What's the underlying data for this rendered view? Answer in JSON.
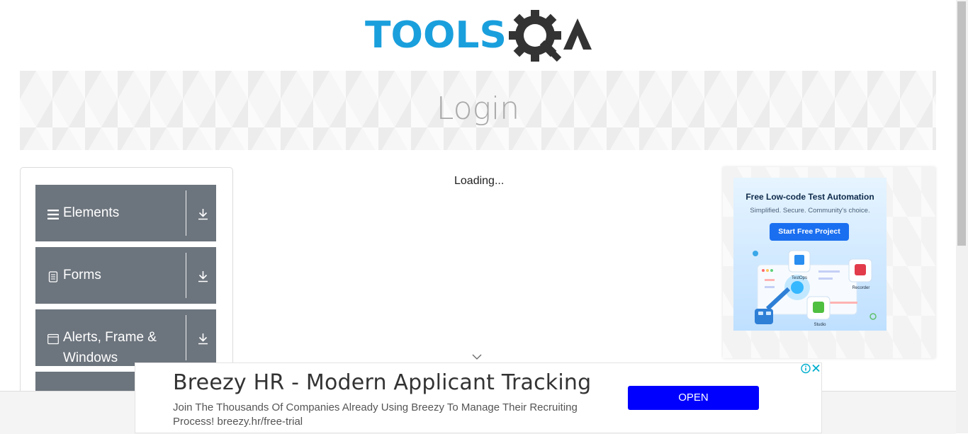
{
  "logo": {
    "text_left": "TOOLS",
    "text_right": "QA"
  },
  "page": {
    "title": "Login",
    "loading_text": "Loading..."
  },
  "sidebar": {
    "groups": [
      {
        "label": "Elements",
        "icon": "hamburger-icon"
      },
      {
        "label": "Forms",
        "icon": "document-icon"
      },
      {
        "label": "Alerts, Frame &",
        "label2": "Windows",
        "icon": "window-icon"
      }
    ]
  },
  "side_ad": {
    "title": "Free Low-code Test Automation",
    "subtitle": "Simplified. Secure. Community's choice.",
    "button": "Start Free Project",
    "products": [
      "TestOps",
      "Recorder",
      "Studio"
    ]
  },
  "bottom_ad": {
    "headline": "Breezy HR - Modern Applicant Tracking",
    "description": "Join The Thousands Of Companies Already Using Breezy To Manage Their Recruiting Process! breezy.hr/free-trial",
    "button": "OPEN"
  },
  "colors": {
    "brand_blue": "#1a9fdd",
    "brand_dark": "#333333",
    "sidebar_group": "#6c747d",
    "ad_open_button": "#0000ff"
  }
}
